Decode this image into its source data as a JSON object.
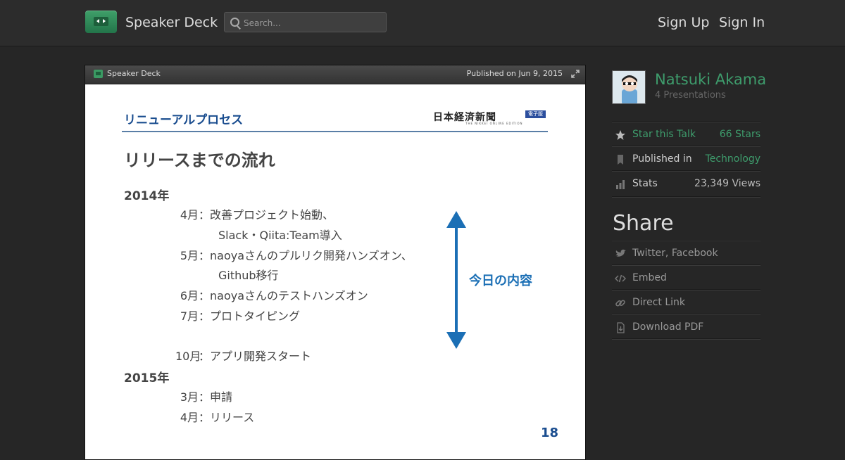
{
  "header": {
    "brand": "Speaker Deck",
    "search_placeholder": "Search...",
    "sign_up": "Sign Up",
    "sign_in": "Sign In"
  },
  "deck": {
    "brand": "Speaker Deck",
    "published": "Published on Jun 9, 2015",
    "slide": {
      "header": "リニューアルプロセス",
      "newspaper": "日本経済新聞",
      "newspaper_badge": "電子版",
      "newspaper_sub": "THE NIKKEI ONLINE EDITION",
      "title": "リリースまでの流れ",
      "year_2014": "2014年",
      "year_2015": "2015年",
      "entries": [
        {
          "month": "4月",
          "text": "改善プロジェクト始動、"
        },
        {
          "month": "",
          "text": "Slack・Qiita:Team導入"
        },
        {
          "month": "5月",
          "text": "naoyaさんのプルリク開発ハンズオン、"
        },
        {
          "month": "",
          "text": "Github移行"
        },
        {
          "month": "6月",
          "text": "naoyaさんのテストハンズオン"
        },
        {
          "month": "7月",
          "text": "プロトタイピング"
        },
        {
          "month": "10月",
          "text": "アプリ開発スタート"
        },
        {
          "month": "3月",
          "text": "申請"
        },
        {
          "month": "4月",
          "text": "リリース"
        }
      ],
      "separator": "：",
      "today_label": "今日の内容",
      "page_number": "18"
    }
  },
  "sidebar": {
    "author": "Natsuki Akama",
    "presentations": "4 Presentations",
    "star_label": "Star this Talk",
    "star_count": "66 Stars",
    "published_in_label": "Published in",
    "category": "Technology",
    "stats_label": "Stats",
    "views": "23,349 Views",
    "share_title": "Share",
    "share_social": "Twitter, Facebook",
    "embed": "Embed",
    "direct_link": "Direct Link",
    "download_pdf": "Download PDF"
  },
  "colors": {
    "accent_green": "#3e9c6c",
    "slide_blue": "#1b6fb5",
    "background": "#262626"
  },
  "icons": [
    "speakerdeck-logo-icon",
    "search-icon",
    "expand-icon",
    "star-icon",
    "bookmark-icon",
    "stats-icon",
    "twitter-bird-icon",
    "code-icon",
    "link-icon",
    "download-icon"
  ]
}
